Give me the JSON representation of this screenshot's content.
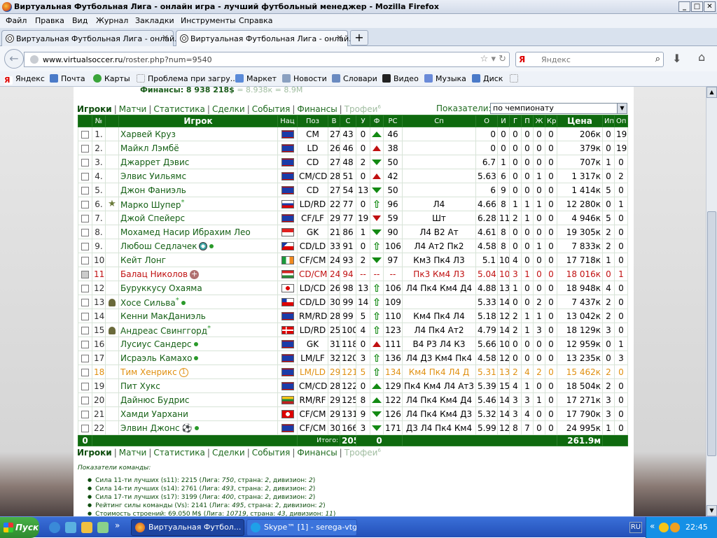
{
  "window": {
    "title": "Виртуальная Футбольная Лига - онлайн игра - лучший футбольный менеджер - Mozilla Firefox",
    "min": "_",
    "max": "□",
    "close": "✕"
  },
  "menu": [
    "Файл",
    "Правка",
    "Вид",
    "Журнал",
    "Закладки",
    "Инструменты",
    "Справка"
  ],
  "tabs": [
    {
      "label": "Виртуальная Футбольная Лига - онлай...",
      "active": false
    },
    {
      "label": "Виртуальная Футбольная Лига - онлай...",
      "active": true
    }
  ],
  "nav": {
    "url_domain": "www.virtualsoccer.ru",
    "url_path": "/roster.php?num=9540",
    "search_engine": "Я",
    "search_placeholder": "Яндекс"
  },
  "bookmarks": [
    "Яндекс",
    "Почта",
    "Карты",
    "Проблема при загру...",
    "Маркет",
    "Новости",
    "Словари",
    "Видео",
    "Музыка",
    "Диск"
  ],
  "page": {
    "finance_label": "Финансы: 8 938 218$",
    "finance_extra": " = 8.938к = 8.9М",
    "links": [
      "Игроки",
      "Матчи",
      "Статистика",
      "Сделки",
      "События",
      "Финансы",
      "Трофеи"
    ],
    "trophy_sup": "6",
    "indicators_label": "Показатели:",
    "indicators_value": "по чемпионату"
  },
  "table": {
    "headers": [
      "№",
      "Игрок",
      "Нац",
      "Поз",
      "В",
      "С",
      "У",
      "Ф",
      "РС",
      "Сп",
      "О",
      "И",
      "Г",
      "П",
      "Ж",
      "Кр",
      "Цена",
      "Ип",
      "Оп"
    ],
    "rows": [
      {
        "n": "1.",
        "name": "Харвей Круз",
        "nat": "belize",
        "pos": "CM",
        "v": "27",
        "s": "43",
        "u": "0",
        "f": "up",
        "rs": "46",
        "sp": "",
        "o": "0",
        "i": "0",
        "g": "0",
        "p": "0",
        "zh": "0",
        "kr": "0",
        "price": "206к",
        "ip": "0",
        "op": "19",
        "style": "",
        "icon": "",
        "mark": ""
      },
      {
        "n": "2.",
        "name": "Майкл Лэмбё",
        "nat": "belize",
        "pos": "LD",
        "v": "26",
        "s": "46",
        "u": "0",
        "f": "upR",
        "rs": "38",
        "sp": "",
        "o": "0",
        "i": "0",
        "g": "0",
        "p": "0",
        "zh": "0",
        "kr": "0",
        "price": "379к",
        "ip": "0",
        "op": "19",
        "style": "",
        "icon": "",
        "mark": ""
      },
      {
        "n": "3.",
        "name": "Джаррет Дэвис",
        "nat": "belize",
        "pos": "CD",
        "v": "27",
        "s": "48",
        "u": "2",
        "f": "down",
        "rs": "50",
        "sp": "",
        "o": "6.7",
        "i": "1",
        "g": "0",
        "p": "0",
        "zh": "0",
        "kr": "0",
        "price": "707к",
        "ip": "1",
        "op": "0",
        "style": "",
        "icon": "",
        "mark": ""
      },
      {
        "n": "4.",
        "name": "Элвис Уильямс",
        "nat": "belize",
        "pos": "CM/CD",
        "v": "28",
        "s": "51",
        "u": "0",
        "f": "upR",
        "rs": "42",
        "sp": "",
        "o": "5.63",
        "i": "6",
        "g": "0",
        "p": "0",
        "zh": "1",
        "kr": "0",
        "price": "1 317к",
        "ip": "0",
        "op": "2",
        "style": "",
        "icon": "",
        "mark": ""
      },
      {
        "n": "5.",
        "name": "Джон Фаниэль",
        "nat": "belize",
        "pos": "CD",
        "v": "27",
        "s": "54",
        "u": "13",
        "f": "down",
        "rs": "50",
        "sp": "",
        "o": "6",
        "i": "9",
        "g": "0",
        "p": "0",
        "zh": "0",
        "kr": "0",
        "price": "1 414к",
        "ip": "5",
        "op": "0",
        "style": "",
        "icon": "",
        "mark": ""
      },
      {
        "n": "6.",
        "name": "Марко Шупер",
        "nat": "slovenia",
        "pos": "LD/RD",
        "v": "22",
        "s": "77",
        "u": "0",
        "f": "arrow",
        "rs": "96",
        "sp": "Л4",
        "o": "4.66",
        "i": "8",
        "g": "1",
        "p": "1",
        "zh": "1",
        "kr": "0",
        "price": "12 280к",
        "ip": "0",
        "op": "1",
        "style": "",
        "icon": "star",
        "mark": "star"
      },
      {
        "n": "7.",
        "name": "Джой Спейерс",
        "nat": "belize",
        "pos": "CF/LF",
        "v": "29",
        "s": "77",
        "u": "19",
        "f": "downR",
        "rs": "59",
        "sp": "Шт",
        "o": "6.28",
        "i": "11",
        "g": "2",
        "p": "1",
        "zh": "0",
        "kr": "0",
        "price": "4 946к",
        "ip": "5",
        "op": "0",
        "style": "",
        "icon": "",
        "mark": ""
      },
      {
        "n": "8.",
        "name": "Мохамед Насир Ибрахим Лео",
        "nat": "singapore",
        "pos": "GK",
        "v": "21",
        "s": "86",
        "u": "1",
        "f": "down",
        "rs": "90",
        "sp": "Л4 В2 Ат",
        "o": "4.61",
        "i": "8",
        "g": "0",
        "p": "0",
        "zh": "0",
        "kr": "0",
        "price": "19 305к",
        "ip": "2",
        "op": "0",
        "style": "",
        "icon": "",
        "mark": ""
      },
      {
        "n": "9.",
        "name": "Любош Седлачек",
        "nat": "czech",
        "pos": "CD/LD",
        "v": "33",
        "s": "91",
        "u": "0",
        "f": "arrow",
        "rs": "106",
        "sp": "Л4 Ат2 Пк2",
        "o": "4.58",
        "i": "8",
        "g": "0",
        "p": "0",
        "zh": "1",
        "kr": "0",
        "price": "7 833к",
        "ip": "2",
        "op": "0",
        "style": "",
        "icon": "",
        "mark": "ball"
      },
      {
        "n": "10.",
        "name": "Кейт Лонг",
        "nat": "ireland",
        "pos": "CF/CM",
        "v": "24",
        "s": "93",
        "u": "2",
        "f": "down",
        "rs": "97",
        "sp": "Км3 Пк4 Л3",
        "o": "5.1",
        "i": "10",
        "g": "4",
        "p": "0",
        "zh": "0",
        "kr": "0",
        "price": "17 718к",
        "ip": "1",
        "op": "0",
        "style": "",
        "icon": "",
        "mark": ""
      },
      {
        "n": "11.",
        "name": "Балац Николов",
        "nat": "hungary",
        "pos": "CD/CM",
        "v": "24",
        "s": "94",
        "u": "--",
        "f": "dash",
        "rs": "--",
        "sp": "Пк3 Км4 Л3",
        "o": "5.04",
        "i": "10",
        "g": "3",
        "p": "1",
        "zh": "0",
        "kr": "0",
        "price": "18 016к",
        "ip": "0",
        "op": "1",
        "style": "red",
        "icon": "",
        "mark": "plus"
      },
      {
        "n": "12.",
        "name": "Буруккусу Охаяма",
        "nat": "japan",
        "pos": "LD/CD",
        "v": "26",
        "s": "98",
        "u": "13",
        "f": "arrow",
        "rs": "106",
        "sp": "Л4 Пк4 Км4 Д4",
        "o": "4.88",
        "i": "13",
        "g": "1",
        "p": "0",
        "zh": "0",
        "kr": "0",
        "price": "18 948к",
        "ip": "4",
        "op": "0",
        "style": "",
        "icon": "",
        "mark": ""
      },
      {
        "n": "13.",
        "name": "Хосе Сильва",
        "nat": "chile",
        "pos": "CD/LD",
        "v": "30",
        "s": "99",
        "u": "14",
        "f": "arrow",
        "rs": "109",
        "sp": "",
        "o": "5.33",
        "i": "14",
        "g": "0",
        "p": "0",
        "zh": "2",
        "kr": "0",
        "price": "7 437к",
        "ip": "2",
        "op": "0",
        "style": "",
        "icon": "person",
        "mark": "stardot"
      },
      {
        "n": "14.",
        "name": "Кенни МакДаниэль",
        "nat": "belize",
        "pos": "RM/RD",
        "v": "28",
        "s": "99",
        "u": "5",
        "f": "arrow",
        "rs": "110",
        "sp": "Км4 Пк4 Л4",
        "o": "5.18",
        "i": "12",
        "g": "2",
        "p": "1",
        "zh": "1",
        "kr": "0",
        "price": "13 042к",
        "ip": "2",
        "op": "0",
        "style": "",
        "icon": "",
        "mark": ""
      },
      {
        "n": "15.",
        "name": "Андреас Свинггорд",
        "nat": "denmark",
        "pos": "LD/RD",
        "v": "25",
        "s": "100",
        "u": "4",
        "f": "arrow",
        "rs": "123",
        "sp": "Л4 Пк4 Ат2",
        "o": "4.79",
        "i": "14",
        "g": "2",
        "p": "1",
        "zh": "3",
        "kr": "0",
        "price": "18 129к",
        "ip": "3",
        "op": "0",
        "style": "",
        "icon": "person",
        "mark": "star"
      },
      {
        "n": "16.",
        "name": "Лусиус Сандерс",
        "nat": "belize",
        "pos": "GK",
        "v": "31",
        "s": "118",
        "u": "0",
        "f": "upR",
        "rs": "111",
        "sp": "В4 Р3 Л4 К3",
        "o": "5.66",
        "i": "10",
        "g": "0",
        "p": "0",
        "zh": "0",
        "kr": "0",
        "price": "12 959к",
        "ip": "0",
        "op": "1",
        "style": "",
        "icon": "",
        "mark": "dot"
      },
      {
        "n": "17.",
        "name": "Исраэль Камахо",
        "nat": "belize",
        "pos": "LM/LF",
        "v": "32",
        "s": "120",
        "u": "3",
        "f": "arrow",
        "rs": "136",
        "sp": "Л4 Д3 Км4 Пк4",
        "o": "4.58",
        "i": "12",
        "g": "0",
        "p": "0",
        "zh": "0",
        "kr": "0",
        "price": "13 235к",
        "ip": "0",
        "op": "3",
        "style": "",
        "icon": "",
        "mark": "dot"
      },
      {
        "n": "18.",
        "name": "Тим Хенрикс",
        "nat": "belize",
        "pos": "LM/LD",
        "v": "29",
        "s": "121",
        "u": "5",
        "f": "arrow",
        "rs": "134",
        "sp": "Км4 Пк4 Л4 Д",
        "o": "5.31",
        "i": "13",
        "g": "2",
        "p": "4",
        "zh": "2",
        "kr": "0",
        "price": "15 462к",
        "ip": "2",
        "op": "0",
        "style": "orange",
        "icon": "",
        "mark": "one"
      },
      {
        "n": "19.",
        "name": "Пит Хукс",
        "nat": "belize",
        "pos": "CM/CD",
        "v": "28",
        "s": "122",
        "u": "0",
        "f": "up",
        "rs": "129",
        "sp": "Пк4 Км4 Л4 Ат3",
        "o": "5.39",
        "i": "15",
        "g": "4",
        "p": "1",
        "zh": "0",
        "kr": "0",
        "price": "18 504к",
        "ip": "2",
        "op": "0",
        "style": "",
        "icon": "",
        "mark": ""
      },
      {
        "n": "20.",
        "name": "Дайнюс Будрис",
        "nat": "lithuania",
        "pos": "RM/RF",
        "v": "29",
        "s": "125",
        "u": "8",
        "f": "up",
        "rs": "122",
        "sp": "Л4 Пк4 Км4 Д4",
        "o": "5.46",
        "i": "14",
        "g": "3",
        "p": "3",
        "zh": "1",
        "kr": "0",
        "price": "17 271к",
        "ip": "3",
        "op": "0",
        "style": "",
        "icon": "",
        "mark": ""
      },
      {
        "n": "21.",
        "name": "Хамди Уархани",
        "nat": "tunisia",
        "pos": "CF/CM",
        "v": "29",
        "s": "131",
        "u": "9",
        "f": "down",
        "rs": "126",
        "sp": "Л4 Пк4 Км4 Д3",
        "o": "5.32",
        "i": "14",
        "g": "3",
        "p": "4",
        "zh": "0",
        "kr": "0",
        "price": "17 790к",
        "ip": "3",
        "op": "0",
        "style": "",
        "icon": "",
        "mark": ""
      },
      {
        "n": "22.",
        "name": "Элвин Джонс",
        "nat": "belize",
        "pos": "CF/CM",
        "v": "30",
        "s": "166",
        "u": "3",
        "f": "down",
        "rs": "171",
        "sp": "Д3 Л4 Пк4 Км4",
        "o": "5.99",
        "i": "12",
        "g": "8",
        "p": "7",
        "zh": "0",
        "kr": "0",
        "price": "24 995к",
        "ip": "1",
        "op": "0",
        "style": "",
        "icon": "",
        "mark": "kick"
      }
    ],
    "total": {
      "count": "0",
      "label": "Итого:",
      "sum": "2059",
      "u": "0",
      "price": "261.9м"
    }
  },
  "info": {
    "heading": "Показатели команды:",
    "lines": [
      {
        "a": "Сила 11-ти лучших (s11): 2215 (Лига: ",
        "b": "750",
        ", страна: ": "",
        "c": "2",
        "d": ", дивизион: ",
        "e": "2",
        "f": ")"
      },
      {
        "a": "Сила 14-ти лучших (s14): 2761 (Лига: ",
        "b": "493",
        "c": "2",
        "d": ", дивизион: ",
        "e": "2",
        "f": ")"
      },
      {
        "a": "Сила 17-ти лучших (s17): 3199 (Лига: ",
        "b": "400",
        "c": "2",
        "d": ", дивизион: ",
        "e": "2",
        "f": ")"
      },
      {
        "a": "Рейтинг силы команды (Vs): 2141 (Лига: ",
        "b": "495",
        "c": "2",
        "d": ", дивизион: ",
        "e": "2",
        "f": ")"
      },
      {
        "a": "Стоимость строений: 69.050 М$ (Лига: ",
        "b": "10719",
        "c": "43",
        "d": ", дивизион: ",
        "e": "11",
        "f": ")"
      }
    ],
    "country_sep": ", страна: "
  },
  "taskbar": {
    "start": "Пуск",
    "items": [
      {
        "label": "Виртуальная Футбол...",
        "active": true
      },
      {
        "label": "Skype™ [1] - serega-vtg",
        "active": false
      }
    ],
    "lang": "RU",
    "time": "22:45"
  },
  "colors": {
    "header_green": "#0f6a0f",
    "link_green": "#1e6a1e",
    "red": "#c01010",
    "orange": "#e09010"
  }
}
